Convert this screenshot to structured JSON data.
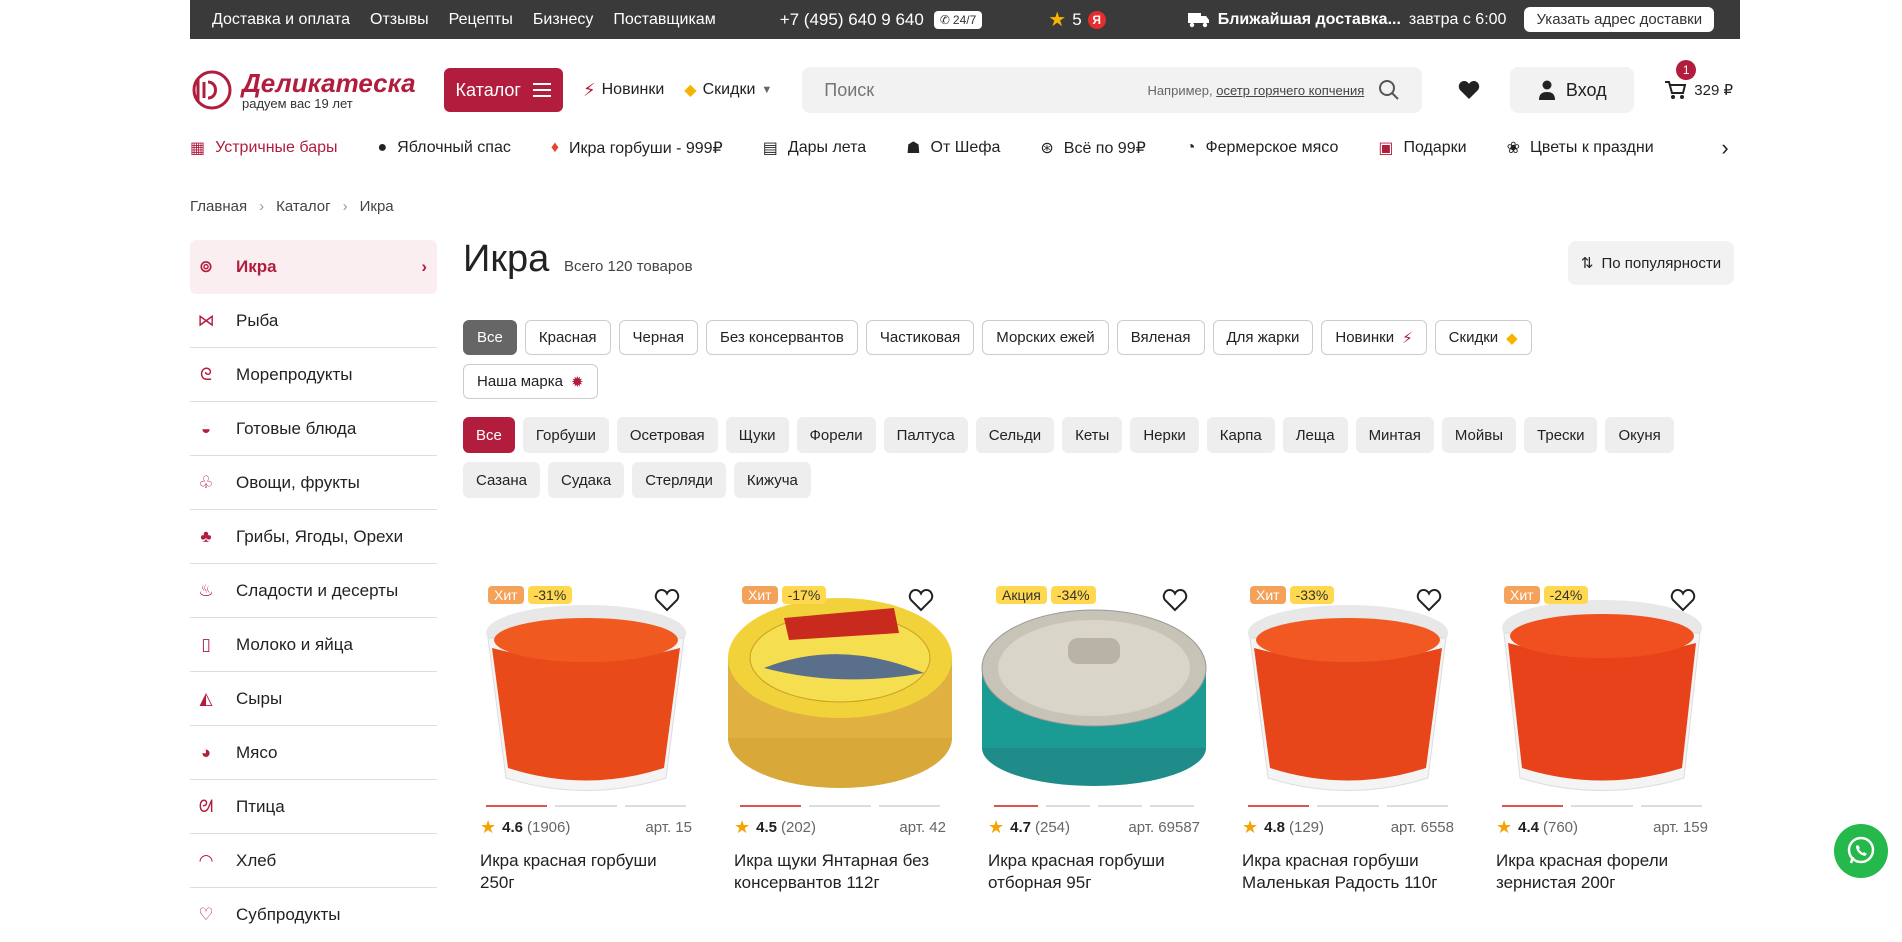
{
  "topbar": {
    "links": [
      "Доставка и оплата",
      "Отзывы",
      "Рецепты",
      "Бизнесу",
      "Поставщикам"
    ],
    "phone": "+7 (495) 640 9 640",
    "badge": "24/7",
    "rating": "5",
    "rating_source": "Я",
    "delivery_bold": "Ближайшая доставка...",
    "delivery_time": "завтра с 6:00",
    "address_button": "Указать адрес доставки"
  },
  "header": {
    "logo_name": "Деликатеска",
    "logo_sub": "радуем вас 19 лет",
    "catalog_label": "Каталог",
    "news_label": "Новинки",
    "discounts_label": "Скидки",
    "search_placeholder": "Поиск",
    "search_hint_prefix": "Например,",
    "search_hint_example": "осетр горячего копчения",
    "login_label": "Вход",
    "cart_count": "1",
    "cart_total": "329 ₽"
  },
  "promo": [
    {
      "label": "Устричные бары",
      "icon": "shop-icon"
    },
    {
      "label": "Яблочный спас",
      "icon": "apple-icon"
    },
    {
      "label": "Икра горбуши - 999₽",
      "icon": "fire-icon"
    },
    {
      "label": "Дары лета",
      "icon": "basket-icon"
    },
    {
      "label": "От Шефа",
      "icon": "chef-hat-icon"
    },
    {
      "label": "Всё по 99₽",
      "icon": "percent-icon"
    },
    {
      "label": "Фермерское мясо",
      "icon": "drumstick-icon"
    },
    {
      "label": "Подарки",
      "icon": "gift-icon"
    },
    {
      "label": "Цветы к праздни",
      "icon": "flowers-icon"
    }
  ],
  "breadcrumb": [
    "Главная",
    "Каталог",
    "Икра"
  ],
  "sidebar": [
    {
      "label": "Икра",
      "icon": "caviar-icon"
    },
    {
      "label": "Рыба",
      "icon": "fish-icon"
    },
    {
      "label": "Морепродукты",
      "icon": "shrimp-icon"
    },
    {
      "label": "Готовые блюда",
      "icon": "dish-icon"
    },
    {
      "label": "Овощи, фрукты",
      "icon": "vegetable-icon"
    },
    {
      "label": "Грибы, Ягоды, Орехи",
      "icon": "mushroom-icon"
    },
    {
      "label": "Сладости и десерты",
      "icon": "cake-icon"
    },
    {
      "label": "Молоко и яйца",
      "icon": "milk-icon"
    },
    {
      "label": "Сыры",
      "icon": "cheese-icon"
    },
    {
      "label": "Мясо",
      "icon": "meat-icon"
    },
    {
      "label": "Птица",
      "icon": "bird-icon"
    },
    {
      "label": "Хлеб",
      "icon": "bread-icon"
    },
    {
      "label": "Субпродукты",
      "icon": "offal-icon"
    }
  ],
  "main": {
    "title": "Икра",
    "count": "Всего 120 товаров",
    "sort_label": "По популярности",
    "type_chips": [
      "Все",
      "Красная",
      "Черная",
      "Без консервантов",
      "Частиковая",
      "Морских ежей",
      "Вяленая",
      "Для жарки",
      "Новинки",
      "Скидки",
      "Наша марка"
    ],
    "fish_chips": [
      "Все",
      "Горбуши",
      "Осетровая",
      "Щуки",
      "Форели",
      "Палтуса",
      "Сельди",
      "Кеты",
      "Нерки",
      "Карпа",
      "Леща",
      "Минтая",
      "Мойвы",
      "Трески",
      "Окуня",
      "Сазана",
      "Судака",
      "Стерляди",
      "Кижуча"
    ]
  },
  "products": [
    {
      "tag": "Хит",
      "discount": "-31%",
      "rating": "4.6",
      "reviews": "(1906)",
      "art": "арт. 15",
      "name": "Икра красная горбуши 250г",
      "image": "red-caviar-tub"
    },
    {
      "tag": "Хит",
      "discount": "-17%",
      "rating": "4.5",
      "reviews": "(202)",
      "art": "арт. 42",
      "name": "Икра щуки Янтарная без консервантов 112г",
      "image": "pike-caviar-jar"
    },
    {
      "tag": "Акция",
      "discount": "-34%",
      "rating": "4.7",
      "reviews": "(254)",
      "art": "арт. 69587",
      "name": "Икра красная горбуши отборная 95г",
      "image": "caviar-tin-can"
    },
    {
      "tag": "Хит",
      "discount": "-33%",
      "rating": "4.8",
      "reviews": "(129)",
      "art": "арт. 6558",
      "name": "Икра красная горбуши Маленькая Радость 110г",
      "image": "red-caviar-tub"
    },
    {
      "tag": "Хит",
      "discount": "-24%",
      "rating": "4.4",
      "reviews": "(760)",
      "art": "арт. 159",
      "name": "Икра красная форели зернистая 200г",
      "image": "red-caviar-tub"
    }
  ],
  "colors": {
    "brand": "#b21d3e",
    "topbar": "#3a3a3a",
    "whatsapp": "#25b84a"
  }
}
